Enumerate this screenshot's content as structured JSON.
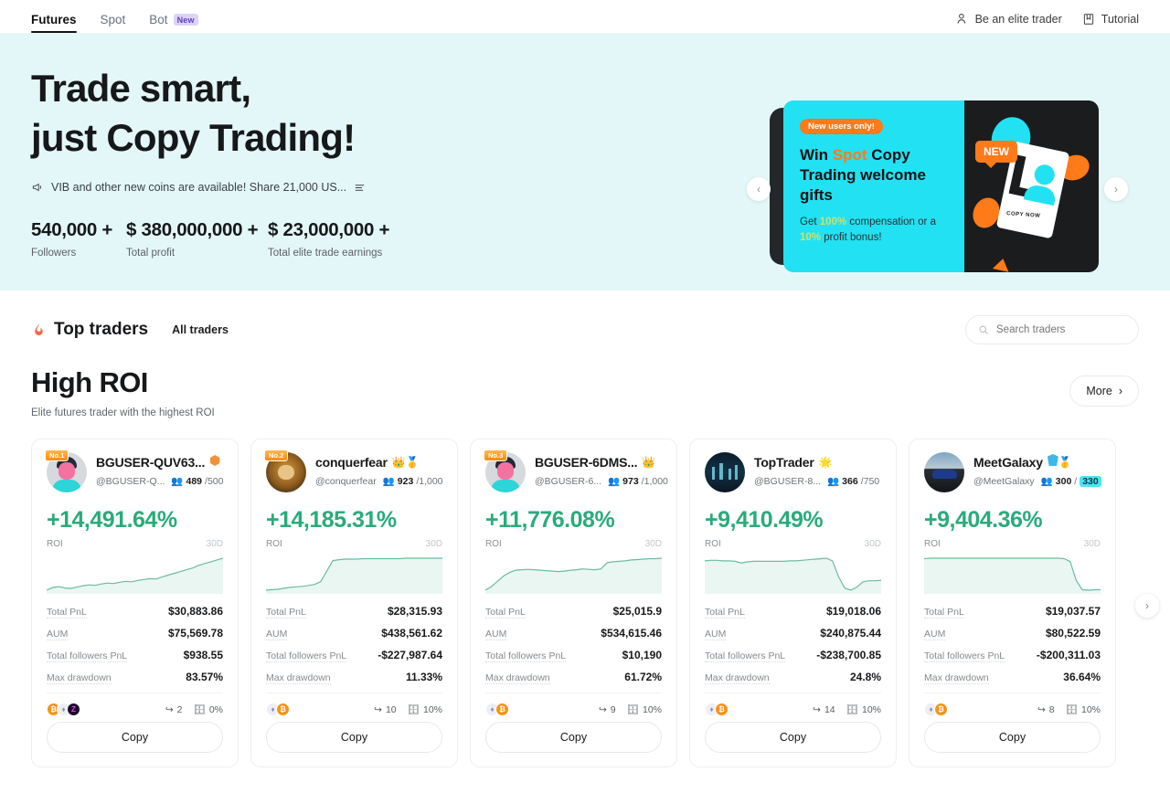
{
  "nav": {
    "tabs": [
      {
        "label": "Futures",
        "active": true
      },
      {
        "label": "Spot",
        "active": false
      },
      {
        "label": "Bot",
        "active": false,
        "badge": "New"
      }
    ],
    "right": [
      {
        "label": "Be an elite trader",
        "icon": "user-icon"
      },
      {
        "label": "Tutorial",
        "icon": "book-icon"
      }
    ]
  },
  "hero": {
    "title_line1": "Trade smart,",
    "title_line2": "just Copy Trading!",
    "announcement": "VIB and other new coins are available! Share 21,000 US...",
    "announcement_icon": "megaphone-icon",
    "list_icon": "list-icon",
    "stats": [
      {
        "value": "540,000 +",
        "label": "Followers"
      },
      {
        "value": "$ 380,000,000 +",
        "label": "Total profit"
      },
      {
        "value": "$ 23,000,000 +",
        "label": "Total elite trade earnings"
      }
    ],
    "promo": {
      "tag": "New users only!",
      "heading_pre": "Win ",
      "heading_hl": "Spot",
      "heading_post": " Copy Trading welcome gifts",
      "sub_pre": "Get ",
      "sub_hl1": "100%",
      "sub_mid": " compensation or a ",
      "sub_hl2": "10%",
      "sub_post": " profit bonus!",
      "badge": "NEW",
      "phone_text": "COPY NOW",
      "prev_icon": "chevron-left-icon",
      "next_icon": "chevron-right-icon",
      "dots": 5,
      "active_dot": 1
    }
  },
  "top_traders": {
    "title": "Top traders",
    "title_icon": "fire-icon",
    "all_traders": "All traders",
    "search_placeholder": "Search traders",
    "search_value": "",
    "search_icon": "search-icon"
  },
  "roi_section": {
    "title": "High ROI",
    "subtitle": "Elite futures trader with the highest ROI",
    "more_label": "More",
    "more_icon": "chevron-right-icon",
    "next_icon": "chevron-right-icon",
    "copy_label": "Copy",
    "labels": {
      "roi": "ROI",
      "period": "30D",
      "total_pnl": "Total PnL",
      "aum": "AUM",
      "followers_pnl": "Total followers PnL",
      "max_drawdown": "Max drawdown"
    },
    "accent_green": "#2aab7b",
    "traders": [
      {
        "rank": "No.1",
        "name": "BGUSER-QUV63...",
        "handle": "@BGUSER-Q...",
        "followers": "489",
        "capacity": "/500",
        "capacity_full": false,
        "badges": [
          "hex-orange-icon"
        ],
        "avatar": "person-avatar",
        "roi": "+14,491.64%",
        "total_pnl": "$30,883.86",
        "aum": "$75,569.78",
        "followers_pnl": "$938.55",
        "max_drawdown": "83.57%",
        "coins": [
          "btc-icon",
          "eth-icon",
          "zen-icon"
        ],
        "trades": "2",
        "fee": "0%",
        "chart": "14,20,22,19,18,21,24,26,25,28,30,29,32,34,33,36,38,40,39,44,48,52,56,60,64,70,74,78,82,86"
      },
      {
        "rank": "No.2",
        "name": "conquerfear",
        "handle": "@conquerfear",
        "followers": "923",
        "capacity": "/1,000",
        "capacity_full": false,
        "badges": [
          "crown-icon",
          "medal-icon"
        ],
        "avatar": "lion-avatar",
        "roi": "+14,185.31%",
        "total_pnl": "$28,315.93",
        "aum": "$438,561.62",
        "followers_pnl": "-$227,987.64",
        "max_drawdown": "11.33%",
        "coins": [
          "eth-icon",
          "btc-icon"
        ],
        "trades": "10",
        "fee": "10%",
        "chart": "12,13,14,16,18,19,20,22,24,30,52,74,76,77,77,77,78,78,78,78,78,78,78,79,79,79,79,79,79,79"
      },
      {
        "rank": "No.3",
        "name": "BGUSER-6DMS...",
        "handle": "@BGUSER-6...",
        "followers": "973",
        "capacity": "/1,000",
        "capacity_full": false,
        "badges": [
          "crown-icon"
        ],
        "avatar": "person-avatar",
        "roi": "+11,776.08%",
        "total_pnl": "$25,015.9",
        "aum": "$534,615.46",
        "followers_pnl": "$10,190",
        "max_drawdown": "61.72%",
        "coins": [
          "eth-icon",
          "btc-icon"
        ],
        "trades": "9",
        "fee": "10%",
        "chart": "10,18,30,42,50,55,56,57,56,55,54,53,52,53,55,56,58,57,56,58,72,74,75,76,78,79,80,81,81,82"
      },
      {
        "rank": "",
        "name": "TopTrader",
        "handle": "@BGUSER-8...",
        "followers": "366",
        "capacity": "/750",
        "capacity_full": false,
        "badges": [
          "star-badge-icon"
        ],
        "avatar": "city-avatar",
        "roi": "+9,410.49%",
        "total_pnl": "$19,018.06",
        "aum": "$240,875.44",
        "followers_pnl": "-$238,700.85",
        "max_drawdown": "24.8%",
        "coins": [
          "eth-icon",
          "btc-icon"
        ],
        "trades": "14",
        "fee": "10%",
        "chart": "70,71,71,70,70,69,66,68,69,69,69,69,69,69,70,70,71,72,73,74,75,70,40,18,14,20,30,32,32,33"
      },
      {
        "rank": "",
        "name": "MeetGalaxy",
        "handle": "@MeetGalaxy",
        "followers": "300",
        "capacity": "330",
        "capacity_full": true,
        "badges": [
          "shield-icon",
          "medal-icon"
        ],
        "avatar": "car-avatar",
        "roi": "+9,404.36%",
        "total_pnl": "$19,037.57",
        "aum": "$80,522.59",
        "followers_pnl": "-$200,311.03",
        "max_drawdown": "36.64%",
        "coins": [
          "eth-icon",
          "btc-icon"
        ],
        "trades": "8",
        "fee": "10%",
        "chart": "76,77,77,77,77,77,77,77,77,77,77,77,77,77,77,77,77,77,77,77,77,77,77,76,70,30,10,9,10,10"
      }
    ]
  }
}
